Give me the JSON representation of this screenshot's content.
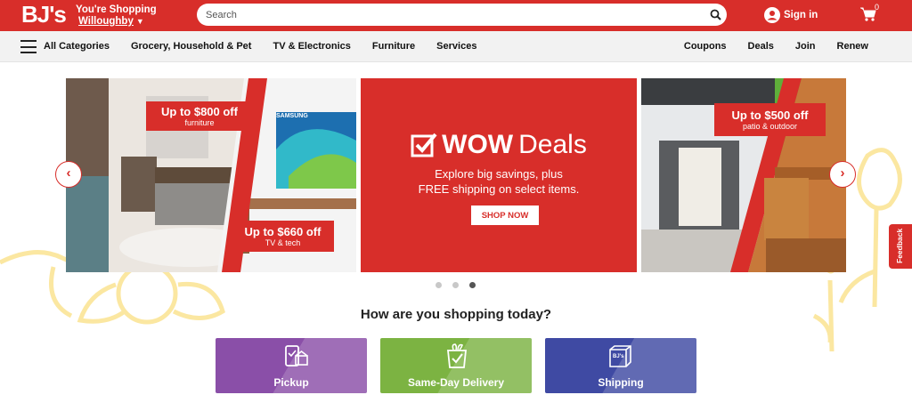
{
  "header": {
    "logo_text": "BJ's",
    "shopping_label": "You're Shopping",
    "store_name": "Willoughby",
    "search_placeholder": "Search",
    "signin_label": "Sign in",
    "cart_count": "0",
    "brand_color": "#d82e2a"
  },
  "nav": {
    "all_categories": "All Categories",
    "categories": [
      "Grocery, Household & Pet",
      "TV & Electronics",
      "Furniture",
      "Services"
    ],
    "links": [
      "Coupons",
      "Deals",
      "Join",
      "Renew"
    ]
  },
  "carousel": {
    "left_promo_1": {
      "headline": "Up to $800 off",
      "sub": "furniture"
    },
    "left_promo_2": {
      "headline": "Up to $660 off",
      "sub": "TV & tech"
    },
    "tv_brand": "SAMSUNG",
    "center": {
      "title_bold": "WOW",
      "title_light": "Deals",
      "line1": "Explore big savings, plus",
      "line2": "FREE shipping on select items.",
      "cta": "SHOP NOW"
    },
    "right_promo": {
      "headline": "Up to $500 off",
      "sub": "patio & outdoor"
    },
    "prev_icon": "chevron-left-icon",
    "next_icon": "chevron-right-icon",
    "active_dot": 3
  },
  "feedback_label": "Feedback",
  "shopping_modes": {
    "title": "How are you shopping today?",
    "options": [
      {
        "label": "Pickup",
        "icon": "pickup-icon",
        "color": "#8a4fa8"
      },
      {
        "label": "Same-Day Delivery",
        "icon": "grocery-bag-icon",
        "color": "#7cb342"
      },
      {
        "label": "Shipping",
        "icon": "package-icon",
        "color": "#3f4aa3",
        "box_text": "BJ's"
      }
    ]
  }
}
